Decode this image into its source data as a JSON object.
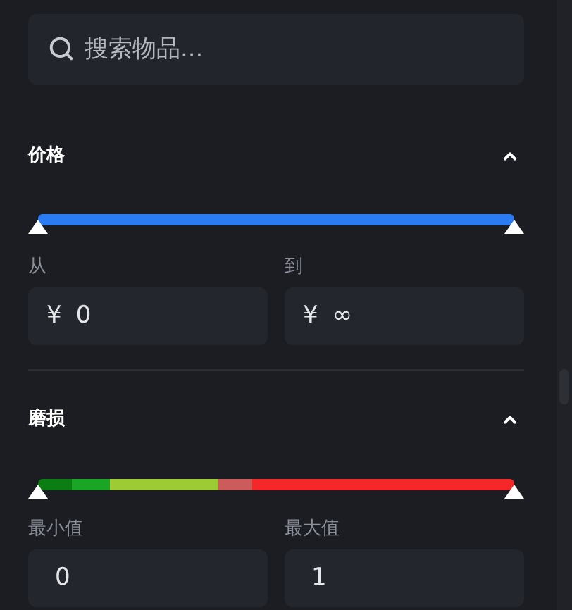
{
  "search": {
    "placeholder": "搜索物品..."
  },
  "sections": [
    {
      "title": "价格",
      "expanded": true,
      "slider": {
        "kind": "solid",
        "color": "#2b7bf2"
      },
      "fields": [
        {
          "label": "从",
          "prefix": "¥",
          "value": "0"
        },
        {
          "label": "到",
          "prefix": "¥",
          "value": "∞"
        }
      ]
    },
    {
      "title": "磨损",
      "expanded": true,
      "slider": {
        "kind": "segments",
        "segments": [
          {
            "color": "#0b7d12"
          },
          {
            "color": "#1ba526"
          },
          {
            "color": "#9ccb36"
          },
          {
            "color": "#cc5b5b"
          },
          {
            "color": "#f42828"
          }
        ]
      },
      "fields": [
        {
          "label": "最小值",
          "value": "0"
        },
        {
          "label": "最大值",
          "value": "1"
        }
      ]
    }
  ]
}
